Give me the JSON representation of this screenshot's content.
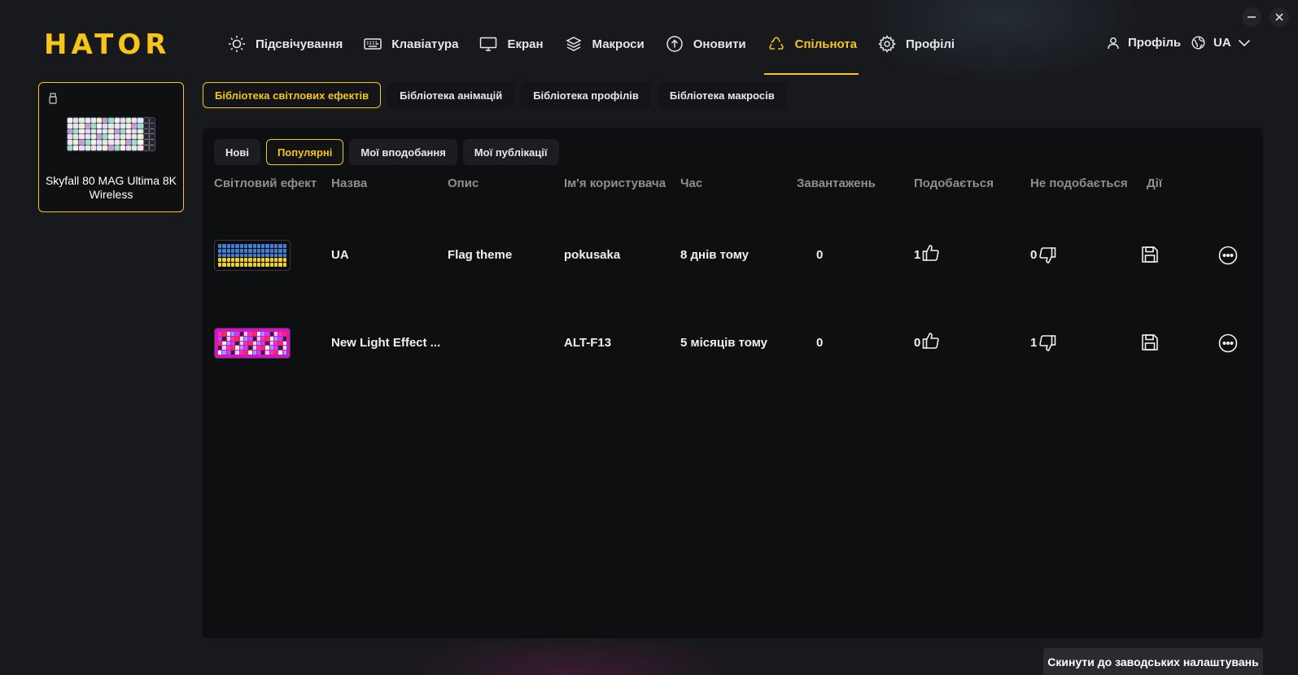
{
  "app": {
    "logo": "HATOR",
    "colors": {
      "accent": "#f5c518",
      "background": "#18191c",
      "panel": "#0e0f10"
    }
  },
  "nav": {
    "items": [
      {
        "label": "Підсвічування",
        "icon": "sun-icon"
      },
      {
        "label": "Клавіатура",
        "icon": "keyboard-icon"
      },
      {
        "label": "Екран",
        "icon": "monitor-icon"
      },
      {
        "label": "Макроси",
        "icon": "layers-icon"
      },
      {
        "label": "Оновити",
        "icon": "upload-circle-icon"
      },
      {
        "label": "Спільнота",
        "icon": "recycle-icon",
        "active": true
      },
      {
        "label": "Профілі",
        "icon": "gear-icon"
      }
    ]
  },
  "header": {
    "profile_label": "Профіль",
    "language": "UA"
  },
  "device": {
    "name": "Skyfall 80 MAG Ultima 8K Wireless"
  },
  "library_tabs": [
    {
      "label": "Бібліотека світлових ефектів",
      "active": true
    },
    {
      "label": "Бібліотека анімацій"
    },
    {
      "label": "Бібліотека профілів"
    },
    {
      "label": "Бібліотека макросів"
    }
  ],
  "filters": [
    {
      "label": "Нові"
    },
    {
      "label": "Популярні",
      "active": true
    },
    {
      "label": "Мої вподобання"
    },
    {
      "label": "Мої публікації"
    }
  ],
  "table": {
    "columns": [
      "Світловий ефект",
      "Назва",
      "Опис",
      "Ім'я користувача",
      "Час",
      "Завантажень",
      "Подобається",
      "Не подобається",
      "Дії"
    ],
    "rows": [
      {
        "thumbnail": "ua-flag",
        "name": "UA",
        "description": "Flag theme",
        "user": "pokusaka",
        "time": "8 днів тому",
        "downloads": "0",
        "likes": "1",
        "dislikes": "0"
      },
      {
        "thumbnail": "pink-multi",
        "name": "New Light Effect ...",
        "description": "",
        "user": "ALT-F13",
        "time": "5 місяців тому",
        "downloads": "0",
        "likes": "0",
        "dislikes": "1"
      }
    ]
  },
  "footer": {
    "reset_label": "Скинути до заводських налаштувань"
  }
}
